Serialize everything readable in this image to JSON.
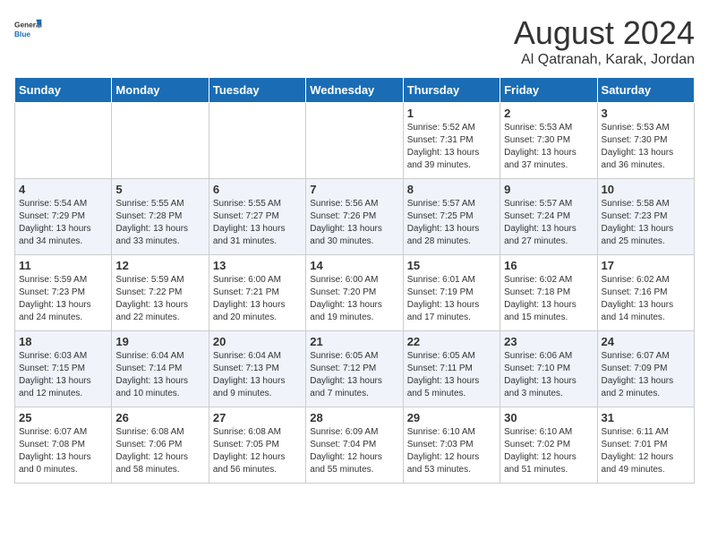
{
  "header": {
    "logo_line1": "General",
    "logo_line2": "Blue",
    "title": "August 2024",
    "subtitle": "Al Qatranah, Karak, Jordan"
  },
  "weekdays": [
    "Sunday",
    "Monday",
    "Tuesday",
    "Wednesday",
    "Thursday",
    "Friday",
    "Saturday"
  ],
  "weeks": [
    {
      "days": [
        {
          "num": "",
          "info": ""
        },
        {
          "num": "",
          "info": ""
        },
        {
          "num": "",
          "info": ""
        },
        {
          "num": "",
          "info": ""
        },
        {
          "num": "1",
          "info": "Sunrise: 5:52 AM\nSunset: 7:31 PM\nDaylight: 13 hours\nand 39 minutes."
        },
        {
          "num": "2",
          "info": "Sunrise: 5:53 AM\nSunset: 7:30 PM\nDaylight: 13 hours\nand 37 minutes."
        },
        {
          "num": "3",
          "info": "Sunrise: 5:53 AM\nSunset: 7:30 PM\nDaylight: 13 hours\nand 36 minutes."
        }
      ]
    },
    {
      "days": [
        {
          "num": "4",
          "info": "Sunrise: 5:54 AM\nSunset: 7:29 PM\nDaylight: 13 hours\nand 34 minutes."
        },
        {
          "num": "5",
          "info": "Sunrise: 5:55 AM\nSunset: 7:28 PM\nDaylight: 13 hours\nand 33 minutes."
        },
        {
          "num": "6",
          "info": "Sunrise: 5:55 AM\nSunset: 7:27 PM\nDaylight: 13 hours\nand 31 minutes."
        },
        {
          "num": "7",
          "info": "Sunrise: 5:56 AM\nSunset: 7:26 PM\nDaylight: 13 hours\nand 30 minutes."
        },
        {
          "num": "8",
          "info": "Sunrise: 5:57 AM\nSunset: 7:25 PM\nDaylight: 13 hours\nand 28 minutes."
        },
        {
          "num": "9",
          "info": "Sunrise: 5:57 AM\nSunset: 7:24 PM\nDaylight: 13 hours\nand 27 minutes."
        },
        {
          "num": "10",
          "info": "Sunrise: 5:58 AM\nSunset: 7:23 PM\nDaylight: 13 hours\nand 25 minutes."
        }
      ]
    },
    {
      "days": [
        {
          "num": "11",
          "info": "Sunrise: 5:59 AM\nSunset: 7:23 PM\nDaylight: 13 hours\nand 24 minutes."
        },
        {
          "num": "12",
          "info": "Sunrise: 5:59 AM\nSunset: 7:22 PM\nDaylight: 13 hours\nand 22 minutes."
        },
        {
          "num": "13",
          "info": "Sunrise: 6:00 AM\nSunset: 7:21 PM\nDaylight: 13 hours\nand 20 minutes."
        },
        {
          "num": "14",
          "info": "Sunrise: 6:00 AM\nSunset: 7:20 PM\nDaylight: 13 hours\nand 19 minutes."
        },
        {
          "num": "15",
          "info": "Sunrise: 6:01 AM\nSunset: 7:19 PM\nDaylight: 13 hours\nand 17 minutes."
        },
        {
          "num": "16",
          "info": "Sunrise: 6:02 AM\nSunset: 7:18 PM\nDaylight: 13 hours\nand 15 minutes."
        },
        {
          "num": "17",
          "info": "Sunrise: 6:02 AM\nSunset: 7:16 PM\nDaylight: 13 hours\nand 14 minutes."
        }
      ]
    },
    {
      "days": [
        {
          "num": "18",
          "info": "Sunrise: 6:03 AM\nSunset: 7:15 PM\nDaylight: 13 hours\nand 12 minutes."
        },
        {
          "num": "19",
          "info": "Sunrise: 6:04 AM\nSunset: 7:14 PM\nDaylight: 13 hours\nand 10 minutes."
        },
        {
          "num": "20",
          "info": "Sunrise: 6:04 AM\nSunset: 7:13 PM\nDaylight: 13 hours\nand 9 minutes."
        },
        {
          "num": "21",
          "info": "Sunrise: 6:05 AM\nSunset: 7:12 PM\nDaylight: 13 hours\nand 7 minutes."
        },
        {
          "num": "22",
          "info": "Sunrise: 6:05 AM\nSunset: 7:11 PM\nDaylight: 13 hours\nand 5 minutes."
        },
        {
          "num": "23",
          "info": "Sunrise: 6:06 AM\nSunset: 7:10 PM\nDaylight: 13 hours\nand 3 minutes."
        },
        {
          "num": "24",
          "info": "Sunrise: 6:07 AM\nSunset: 7:09 PM\nDaylight: 13 hours\nand 2 minutes."
        }
      ]
    },
    {
      "days": [
        {
          "num": "25",
          "info": "Sunrise: 6:07 AM\nSunset: 7:08 PM\nDaylight: 13 hours\nand 0 minutes."
        },
        {
          "num": "26",
          "info": "Sunrise: 6:08 AM\nSunset: 7:06 PM\nDaylight: 12 hours\nand 58 minutes."
        },
        {
          "num": "27",
          "info": "Sunrise: 6:08 AM\nSunset: 7:05 PM\nDaylight: 12 hours\nand 56 minutes."
        },
        {
          "num": "28",
          "info": "Sunrise: 6:09 AM\nSunset: 7:04 PM\nDaylight: 12 hours\nand 55 minutes."
        },
        {
          "num": "29",
          "info": "Sunrise: 6:10 AM\nSunset: 7:03 PM\nDaylight: 12 hours\nand 53 minutes."
        },
        {
          "num": "30",
          "info": "Sunrise: 6:10 AM\nSunset: 7:02 PM\nDaylight: 12 hours\nand 51 minutes."
        },
        {
          "num": "31",
          "info": "Sunrise: 6:11 AM\nSunset: 7:01 PM\nDaylight: 12 hours\nand 49 minutes."
        }
      ]
    }
  ]
}
